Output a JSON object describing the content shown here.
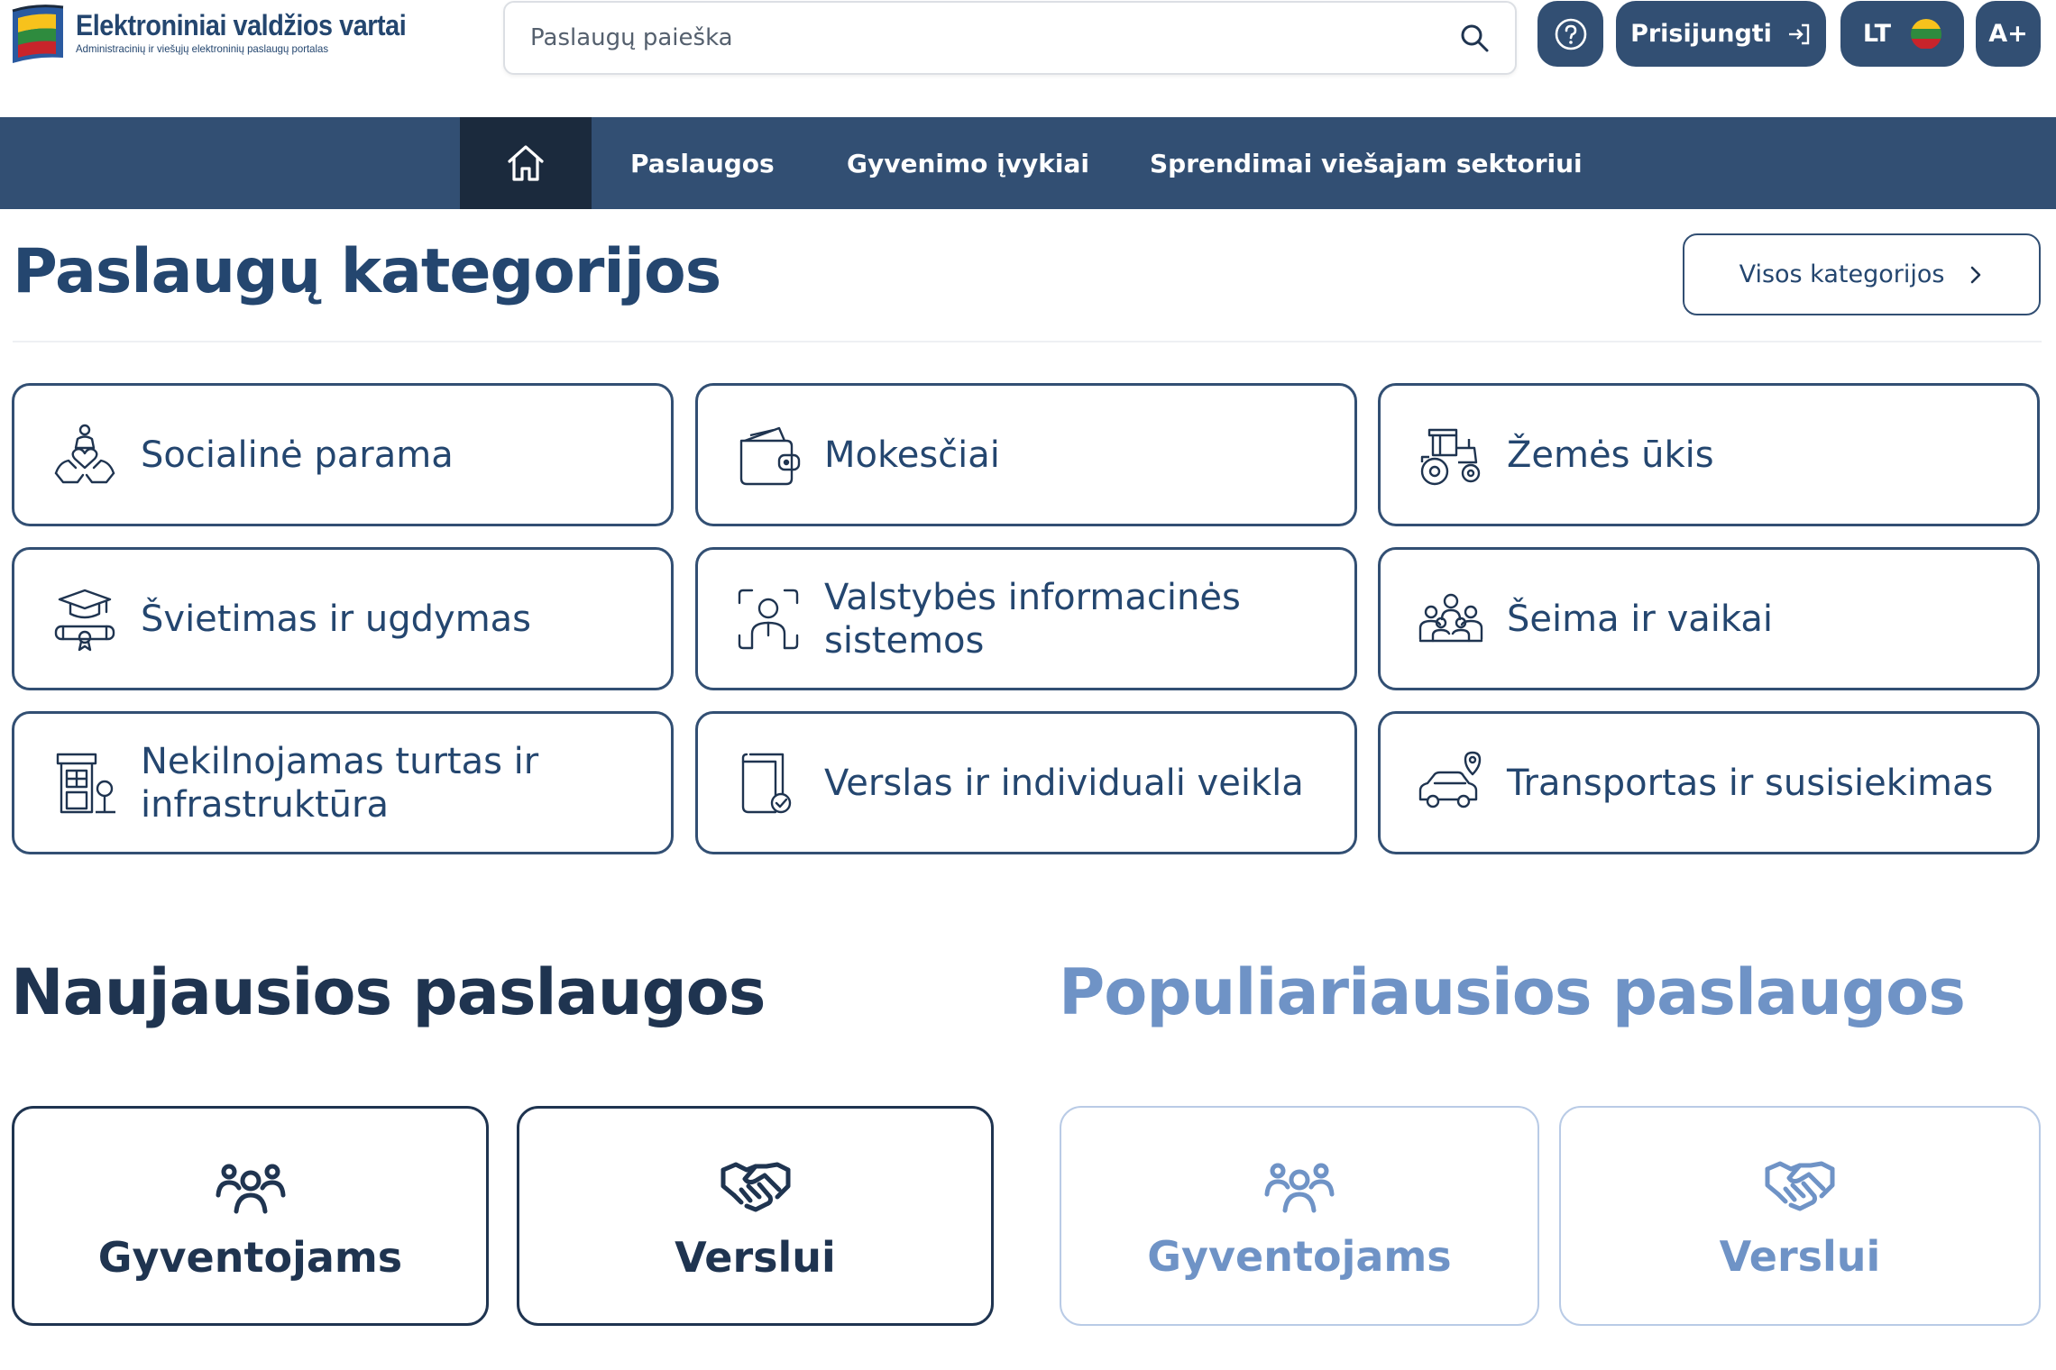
{
  "header": {
    "logo_title": "Elektroniniai valdžios vartai",
    "logo_subtitle": "Administracinių ir viešųjų elektroninių paslaugų portalas",
    "search_placeholder": "Paslaugų paieška",
    "login_label": "Prisijungti",
    "language_label": "LT",
    "font_size_label": "A+"
  },
  "nav": {
    "items": [
      {
        "label": "Paslaugos"
      },
      {
        "label": "Gyvenimo įvykiai"
      },
      {
        "label": "Sprendimai viešajam sektoriui"
      }
    ]
  },
  "categories": {
    "title": "Paslaugų kategorijos",
    "all_label": "Visos kategorijos",
    "items": [
      {
        "label": "Socialinė parama",
        "icon": "social-support-icon"
      },
      {
        "label": "Mokesčiai",
        "icon": "wallet-icon"
      },
      {
        "label": "Žemės ūkis",
        "icon": "tractor-icon"
      },
      {
        "label": "Švietimas ir ugdymas",
        "icon": "graduation-icon"
      },
      {
        "label": "Valstybės informacinės sistemos",
        "icon": "person-scan-icon"
      },
      {
        "label": "Šeima ir vaikai",
        "icon": "family-icon"
      },
      {
        "label": "Nekilnojamas turtas ir infrastruktūra",
        "icon": "building-icon"
      },
      {
        "label": "Verslas ir individuali veikla",
        "icon": "document-check-icon"
      },
      {
        "label": "Transportas ir susisiekimas",
        "icon": "car-location-icon"
      }
    ]
  },
  "newest": {
    "title": "Naujausios paslaugos",
    "residents_label": "Gyventojams",
    "business_label": "Verslui"
  },
  "popular": {
    "title": "Populiariausios paslaugos",
    "residents_label": "Gyventojams",
    "business_label": "Verslui"
  },
  "colors": {
    "primary": "#324f73",
    "dark": "#1b2a3d",
    "text": "#24466f",
    "light_accent": "#6f93c6",
    "light_border": "#b9cbe6"
  }
}
